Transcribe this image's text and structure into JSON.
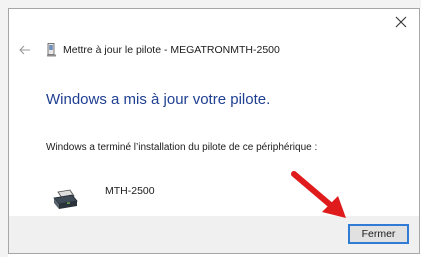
{
  "window": {
    "close_icon": "close-icon"
  },
  "header": {
    "back_icon": "back-arrow-icon",
    "driver_icon": "driver-icon",
    "title": "Mettre à jour le pilote - MEGATRONMTH-2500"
  },
  "main": {
    "heading": "Windows a mis à jour votre pilote.",
    "info": "Windows a terminé l’installation du pilote de ce périphérique :",
    "device": {
      "icon": "printer-icon",
      "name": "MTH-2500"
    }
  },
  "footer": {
    "close_label": "Fermer"
  },
  "colors": {
    "heading": "#1f3f91",
    "button_focus": "#2f7bd6",
    "annotation": "#e01b1b",
    "footer_bg": "#f0f0f0"
  }
}
